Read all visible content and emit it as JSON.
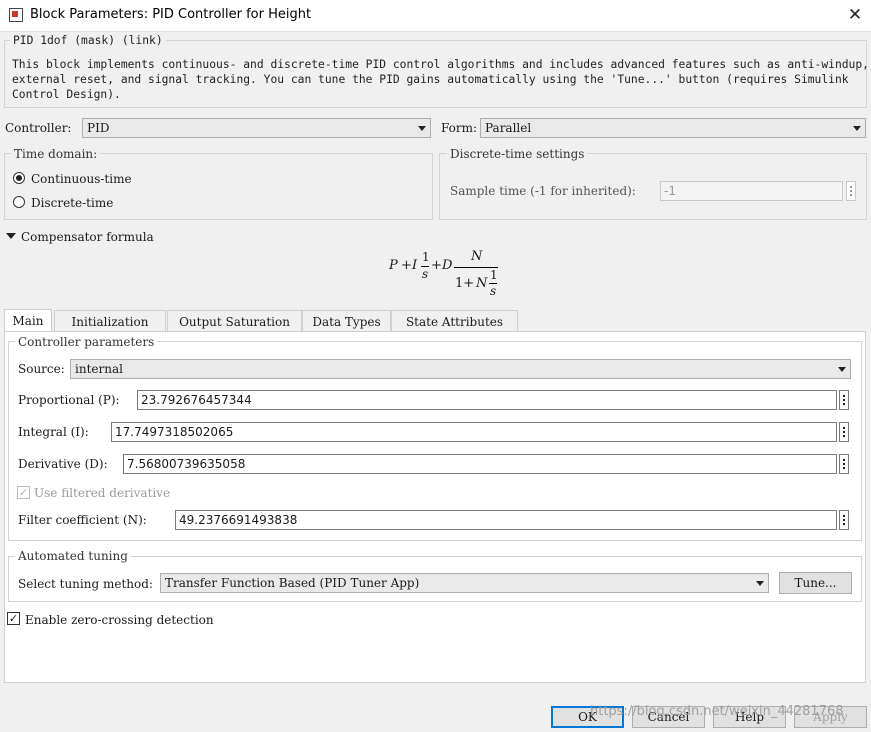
{
  "window": {
    "title": "Block Parameters: PID Controller for Height",
    "close_glyph": "✕"
  },
  "mask": {
    "header": "PID 1dof (mask) (link)",
    "description_lines": [
      "This block implements continuous- and discrete-time PID control algorithms and includes advanced features such as anti-windup,",
      "external reset, and signal tracking. You can tune the PID gains automatically using the 'Tune...' button (requires Simulink",
      "Control Design)."
    ]
  },
  "controller": {
    "label": "Controller:",
    "value": "PID"
  },
  "form": {
    "label": "Form:",
    "value": "Parallel"
  },
  "time_domain": {
    "legend": "Time domain:",
    "options": [
      {
        "label": "Continuous-time",
        "selected": true
      },
      {
        "label": "Discrete-time",
        "selected": false
      }
    ]
  },
  "discrete_settings": {
    "legend": "Discrete-time settings",
    "sample_time_label": "Sample time (-1 for inherited):",
    "sample_time_value": "-1"
  },
  "compensator": {
    "toggle_label": "Compensator formula",
    "formula": {
      "p": "P",
      "plus": "+",
      "i": "I",
      "one": "1",
      "s": "s",
      "d": "D",
      "n": "N",
      "one_plus": "1+"
    }
  },
  "tabs": [
    {
      "label": "Main",
      "active": true
    },
    {
      "label": "Initialization",
      "active": false
    },
    {
      "label": "Output Saturation",
      "active": false
    },
    {
      "label": "Data Types",
      "active": false
    },
    {
      "label": "State Attributes",
      "active": false
    }
  ],
  "controller_parameters": {
    "legend": "Controller parameters",
    "source_label": "Source:",
    "source_value": "internal",
    "proportional_label": "Proportional (P):",
    "proportional_value": "23.792676457344",
    "integral_label": "Integral (I):",
    "integral_value": "17.7497318502065",
    "derivative_label": "Derivative (D):",
    "derivative_value": "7.56800739635058",
    "use_filtered_label": "Use filtered derivative",
    "use_filtered_checked": true,
    "filter_label": "Filter coefficient (N):",
    "filter_value": "49.2376691493838"
  },
  "automated_tuning": {
    "legend": "Automated tuning",
    "method_label": "Select tuning method:",
    "method_value": "Transfer Function Based (PID Tuner App)",
    "tune_button": "Tune..."
  },
  "zero_crossing": {
    "label": "Enable zero-crossing detection",
    "checked": true
  },
  "buttons": {
    "ok": "OK",
    "cancel": "Cancel",
    "help": "Help",
    "apply": "Apply"
  },
  "watermark": "https://blog.csdn.net/weixin_44281768",
  "colors": {
    "background": "#f0f0f0",
    "panel": "#ffffff",
    "accent": "#0078d7",
    "field_border": "#7a7a7a"
  }
}
